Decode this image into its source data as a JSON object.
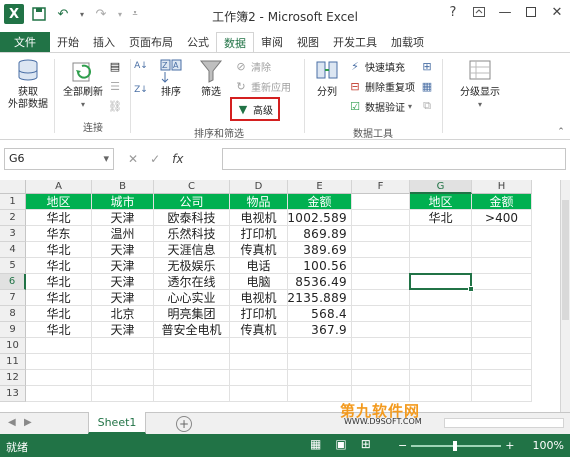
{
  "window": {
    "title": "工作簿2 - Microsoft Excel",
    "help": "?",
    "logo": "X"
  },
  "tabs": [
    "文件",
    "开始",
    "插入",
    "页面布局",
    "公式",
    "数据",
    "审阅",
    "视图",
    "开发工具",
    "加载项"
  ],
  "active_tab": "数据",
  "ribbon": {
    "get_external": "获取\n外部数据",
    "refresh_all": "全部刷新",
    "group_connections": "连接",
    "sort": "排序",
    "filter": "筛选",
    "clear": "清除",
    "reapply": "重新应用",
    "advanced": "高级",
    "group_sort_filter": "排序和筛选",
    "text_to_columns": "分列",
    "flash_fill": "快速填充",
    "remove_duplicates": "删除重复项",
    "data_validation": "数据验证",
    "group_data_tools": "数据工具",
    "outline": "分级显示",
    "accent_color": "#217346",
    "highlight_color": "#d42020"
  },
  "formula_bar": {
    "name_box": "G6",
    "fx": "fx",
    "content": ""
  },
  "grid": {
    "columns": [
      "A",
      "B",
      "C",
      "D",
      "E",
      "F",
      "G",
      "H"
    ],
    "rows": [
      "1",
      "2",
      "3",
      "4",
      "5",
      "6",
      "7",
      "8",
      "9",
      "10",
      "11",
      "12",
      "13"
    ],
    "header_fill": "#00b050",
    "table": {
      "headers": [
        "地区",
        "城市",
        "公司",
        "物品",
        "金额"
      ],
      "data": [
        [
          "华北",
          "天津",
          "欧泰科技",
          "电视机",
          "1002.589"
        ],
        [
          "华东",
          "温州",
          "乐然科技",
          "打印机",
          "869.89"
        ],
        [
          "华北",
          "天津",
          "天涯信息",
          "传真机",
          "389.69"
        ],
        [
          "华北",
          "天津",
          "无极娱乐",
          "电话",
          "100.56"
        ],
        [
          "华北",
          "天津",
          "透尔在线",
          "电脑",
          "8536.49"
        ],
        [
          "华北",
          "天津",
          "心心实业",
          "电视机",
          "2135.889"
        ],
        [
          "华北",
          "北京",
          "明亮集团",
          "打印机",
          "568.4"
        ],
        [
          "华北",
          "天津",
          "普安全电机",
          "传真机",
          "367.9"
        ]
      ]
    },
    "criteria": {
      "headers": [
        "地区",
        "金额"
      ],
      "values": [
        "华北",
        ">400"
      ]
    },
    "selected_cell": "G6"
  },
  "sheets": [
    "Sheet1"
  ],
  "status": {
    "ready": "就绪",
    "zoom": "100%"
  },
  "watermark": {
    "main": "第九软件网",
    "sub": "WWW.D9SOFT.COM"
  }
}
